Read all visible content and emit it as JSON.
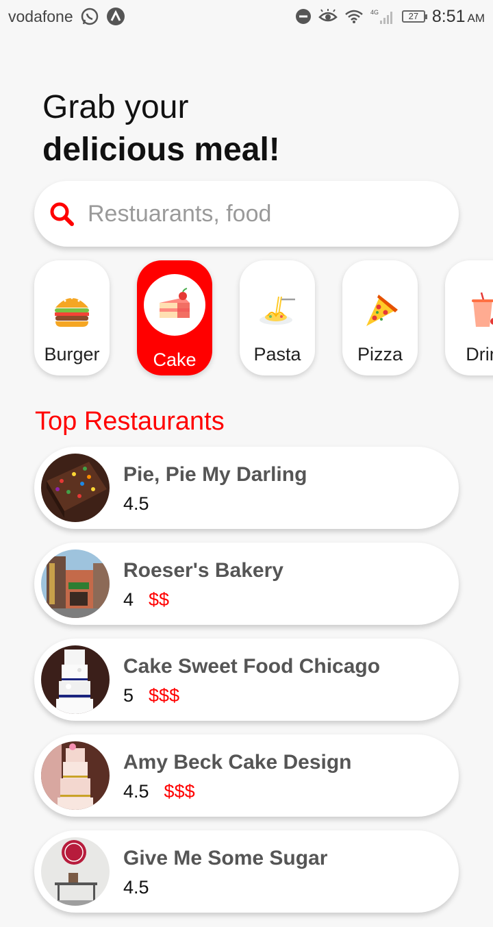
{
  "status_bar": {
    "carrier": "vodafone",
    "battery": "27",
    "time": "8:51",
    "ampm": "AM",
    "network": "4G"
  },
  "header": {
    "line1": "Grab your",
    "line2": "delicious meal!"
  },
  "search": {
    "placeholder": "Restuarants, food",
    "icon": "search-icon"
  },
  "categories": [
    {
      "label": "Burger",
      "icon": "burger-icon",
      "active": false
    },
    {
      "label": "Cake",
      "icon": "cake-icon",
      "active": true
    },
    {
      "label": "Pasta",
      "icon": "pasta-icon",
      "active": false
    },
    {
      "label": "Pizza",
      "icon": "pizza-icon",
      "active": false
    },
    {
      "label": "Drin",
      "icon": "drink-icon",
      "active": false
    }
  ],
  "section_title": "Top Restaurants",
  "restaurants": [
    {
      "name": "Pie, Pie My Darling",
      "rating": "4.5",
      "price": ""
    },
    {
      "name": "Roeser's Bakery",
      "rating": "4",
      "price": "$$"
    },
    {
      "name": "Cake Sweet Food Chicago",
      "rating": "5",
      "price": "$$$"
    },
    {
      "name": "Amy Beck Cake Design",
      "rating": "4.5",
      "price": "$$$"
    },
    {
      "name": "Give Me Some Sugar",
      "rating": "4.5",
      "price": ""
    }
  ],
  "colors": {
    "accent": "#ff0000",
    "background": "#f7f7f7",
    "card": "#ffffff",
    "restaurant_name": "#555555"
  }
}
